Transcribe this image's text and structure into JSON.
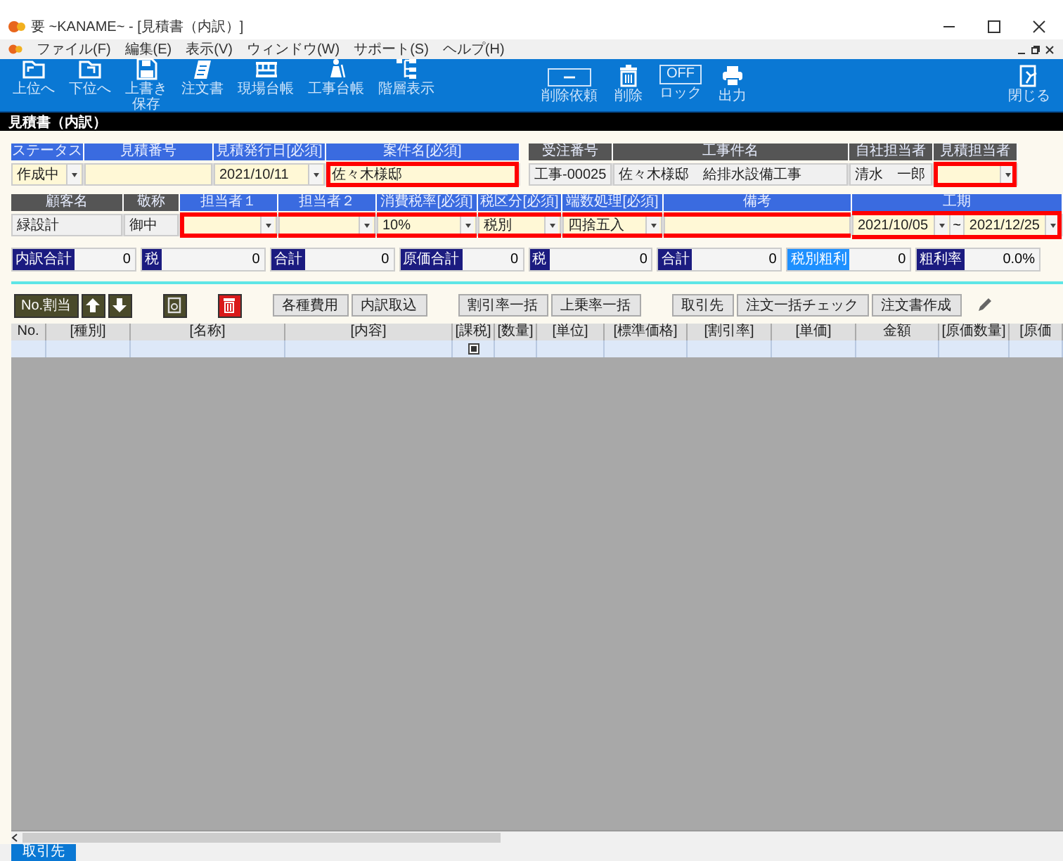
{
  "window": {
    "title": "要 ~KANAME~ - [見積書（内訳）]"
  },
  "menu": [
    "ファイル(F)",
    "編集(E)",
    "表示(V)",
    "ウィンドウ(W)",
    "サポート(S)",
    "ヘルプ(H)"
  ],
  "toolbar": {
    "groups": [
      [
        {
          "label": "上位へ"
        },
        {
          "label": "下位へ"
        },
        {
          "label": "上書き保存"
        },
        {
          "label": "注文書"
        },
        {
          "label": "現場台帳"
        },
        {
          "label": "工事台帳"
        },
        {
          "label": "階層表示"
        }
      ],
      [
        {
          "label": "削除依頼"
        },
        {
          "label": "削除"
        },
        {
          "label": "ロック",
          "toggle_text": "OFF"
        },
        {
          "label": "出力"
        }
      ],
      [
        {
          "label": "閉じる"
        }
      ]
    ]
  },
  "section_title": "見積書（内訳）",
  "form": {
    "rows": [
      {
        "groups": [
          [
            {
              "header": "ステータス",
              "kind": "select",
              "value": "作成中",
              "outlined": false
            },
            {
              "header": "見積番号",
              "kind": "input",
              "outlined": false
            },
            {
              "header": "見積発行日[必須]",
              "kind": "select",
              "value": "2021/10/11",
              "outlined": false
            },
            {
              "header": "案件名[必須]",
              "kind": "input",
              "value": "佐々木様邸",
              "outlined": true
            }
          ],
          [
            {
              "header": "受注番号",
              "kind": "readonly",
              "value": "工事-00025",
              "outlined": false
            },
            {
              "header": "工事件名",
              "kind": "readonly",
              "value": "佐々木様邸　給排水設備工事",
              "outlined": false
            },
            {
              "header": "自社担当者",
              "kind": "readonly",
              "value": "清水　一郎",
              "outlined": false
            },
            {
              "header": "見積担当者",
              "kind": "select",
              "outlined": true
            }
          ]
        ]
      },
      {
        "groups": [
          [
            {
              "header": "顧客名",
              "kind": "readonly",
              "value": "緑設計",
              "outlined": false
            },
            {
              "header": "敬称",
              "kind": "readonly",
              "value": "御中",
              "outlined": false
            },
            {
              "header": "担当者１",
              "kind": "select",
              "outlined": true
            },
            {
              "header": "担当者２",
              "kind": "select",
              "outlined": true
            },
            {
              "header": "消費税率[必須]",
              "kind": "select",
              "value": "10%",
              "outlined": true
            },
            {
              "header": "税区分[必須]",
              "kind": "select",
              "value": "税別",
              "outlined": true
            },
            {
              "header": "端数処理[必須]",
              "kind": "select",
              "value": "四捨五入",
              "outlined": true
            },
            {
              "header": "備考",
              "kind": "input",
              "outlined": true
            },
            {
              "header": "工期",
              "kind": "range",
              "values": [
                "2021/10/05",
                "2021/12/25"
              ],
              "separator": "~",
              "outlined": true
            }
          ]
        ]
      }
    ]
  },
  "totals": [
    {
      "label": "内訳合計",
      "value": "0"
    },
    {
      "label": "税",
      "value": "0"
    },
    {
      "label": "合計",
      "value": "0"
    },
    {
      "label": "原価合計",
      "value": "0"
    },
    {
      "label": "税",
      "value": "0"
    },
    {
      "label": "合計",
      "value": "0"
    },
    {
      "label": "税別粗利",
      "value": "0"
    },
    {
      "label": "粗利率",
      "value": "0.0%"
    }
  ],
  "actions": [
    [
      {
        "kind": "dark",
        "label": "No.割当"
      },
      {
        "kind": "up"
      },
      {
        "kind": "down"
      }
    ],
    [
      {
        "kind": "document"
      }
    ],
    [
      {
        "kind": "trash"
      }
    ],
    [
      {
        "kind": "button",
        "label": "各種費用"
      },
      {
        "kind": "button",
        "label": "内訳取込"
      }
    ],
    [
      {
        "kind": "button",
        "label": "割引率一括"
      },
      {
        "kind": "button",
        "label": "上乗率一括"
      }
    ],
    [
      {
        "kind": "button",
        "label": "取引先"
      },
      {
        "kind": "button",
        "label": "注文一括チェック"
      },
      {
        "kind": "button",
        "label": "注文書作成"
      }
    ],
    [
      {
        "kind": "pencil"
      }
    ]
  ],
  "table": {
    "columns": [
      "No.",
      "[種別]",
      "[名称]",
      "[内容]",
      "[課税]",
      "[数量]",
      "[単位]",
      "[標準価格]",
      "[割引率]",
      "[単価]",
      "金額",
      "[原価数量]",
      "[原価"
    ],
    "rows": [
      {
        "taxable_checked": true
      }
    ]
  },
  "status_bar": {
    "tabs": [
      {
        "label": "取引先",
        "selected": true
      }
    ]
  }
}
